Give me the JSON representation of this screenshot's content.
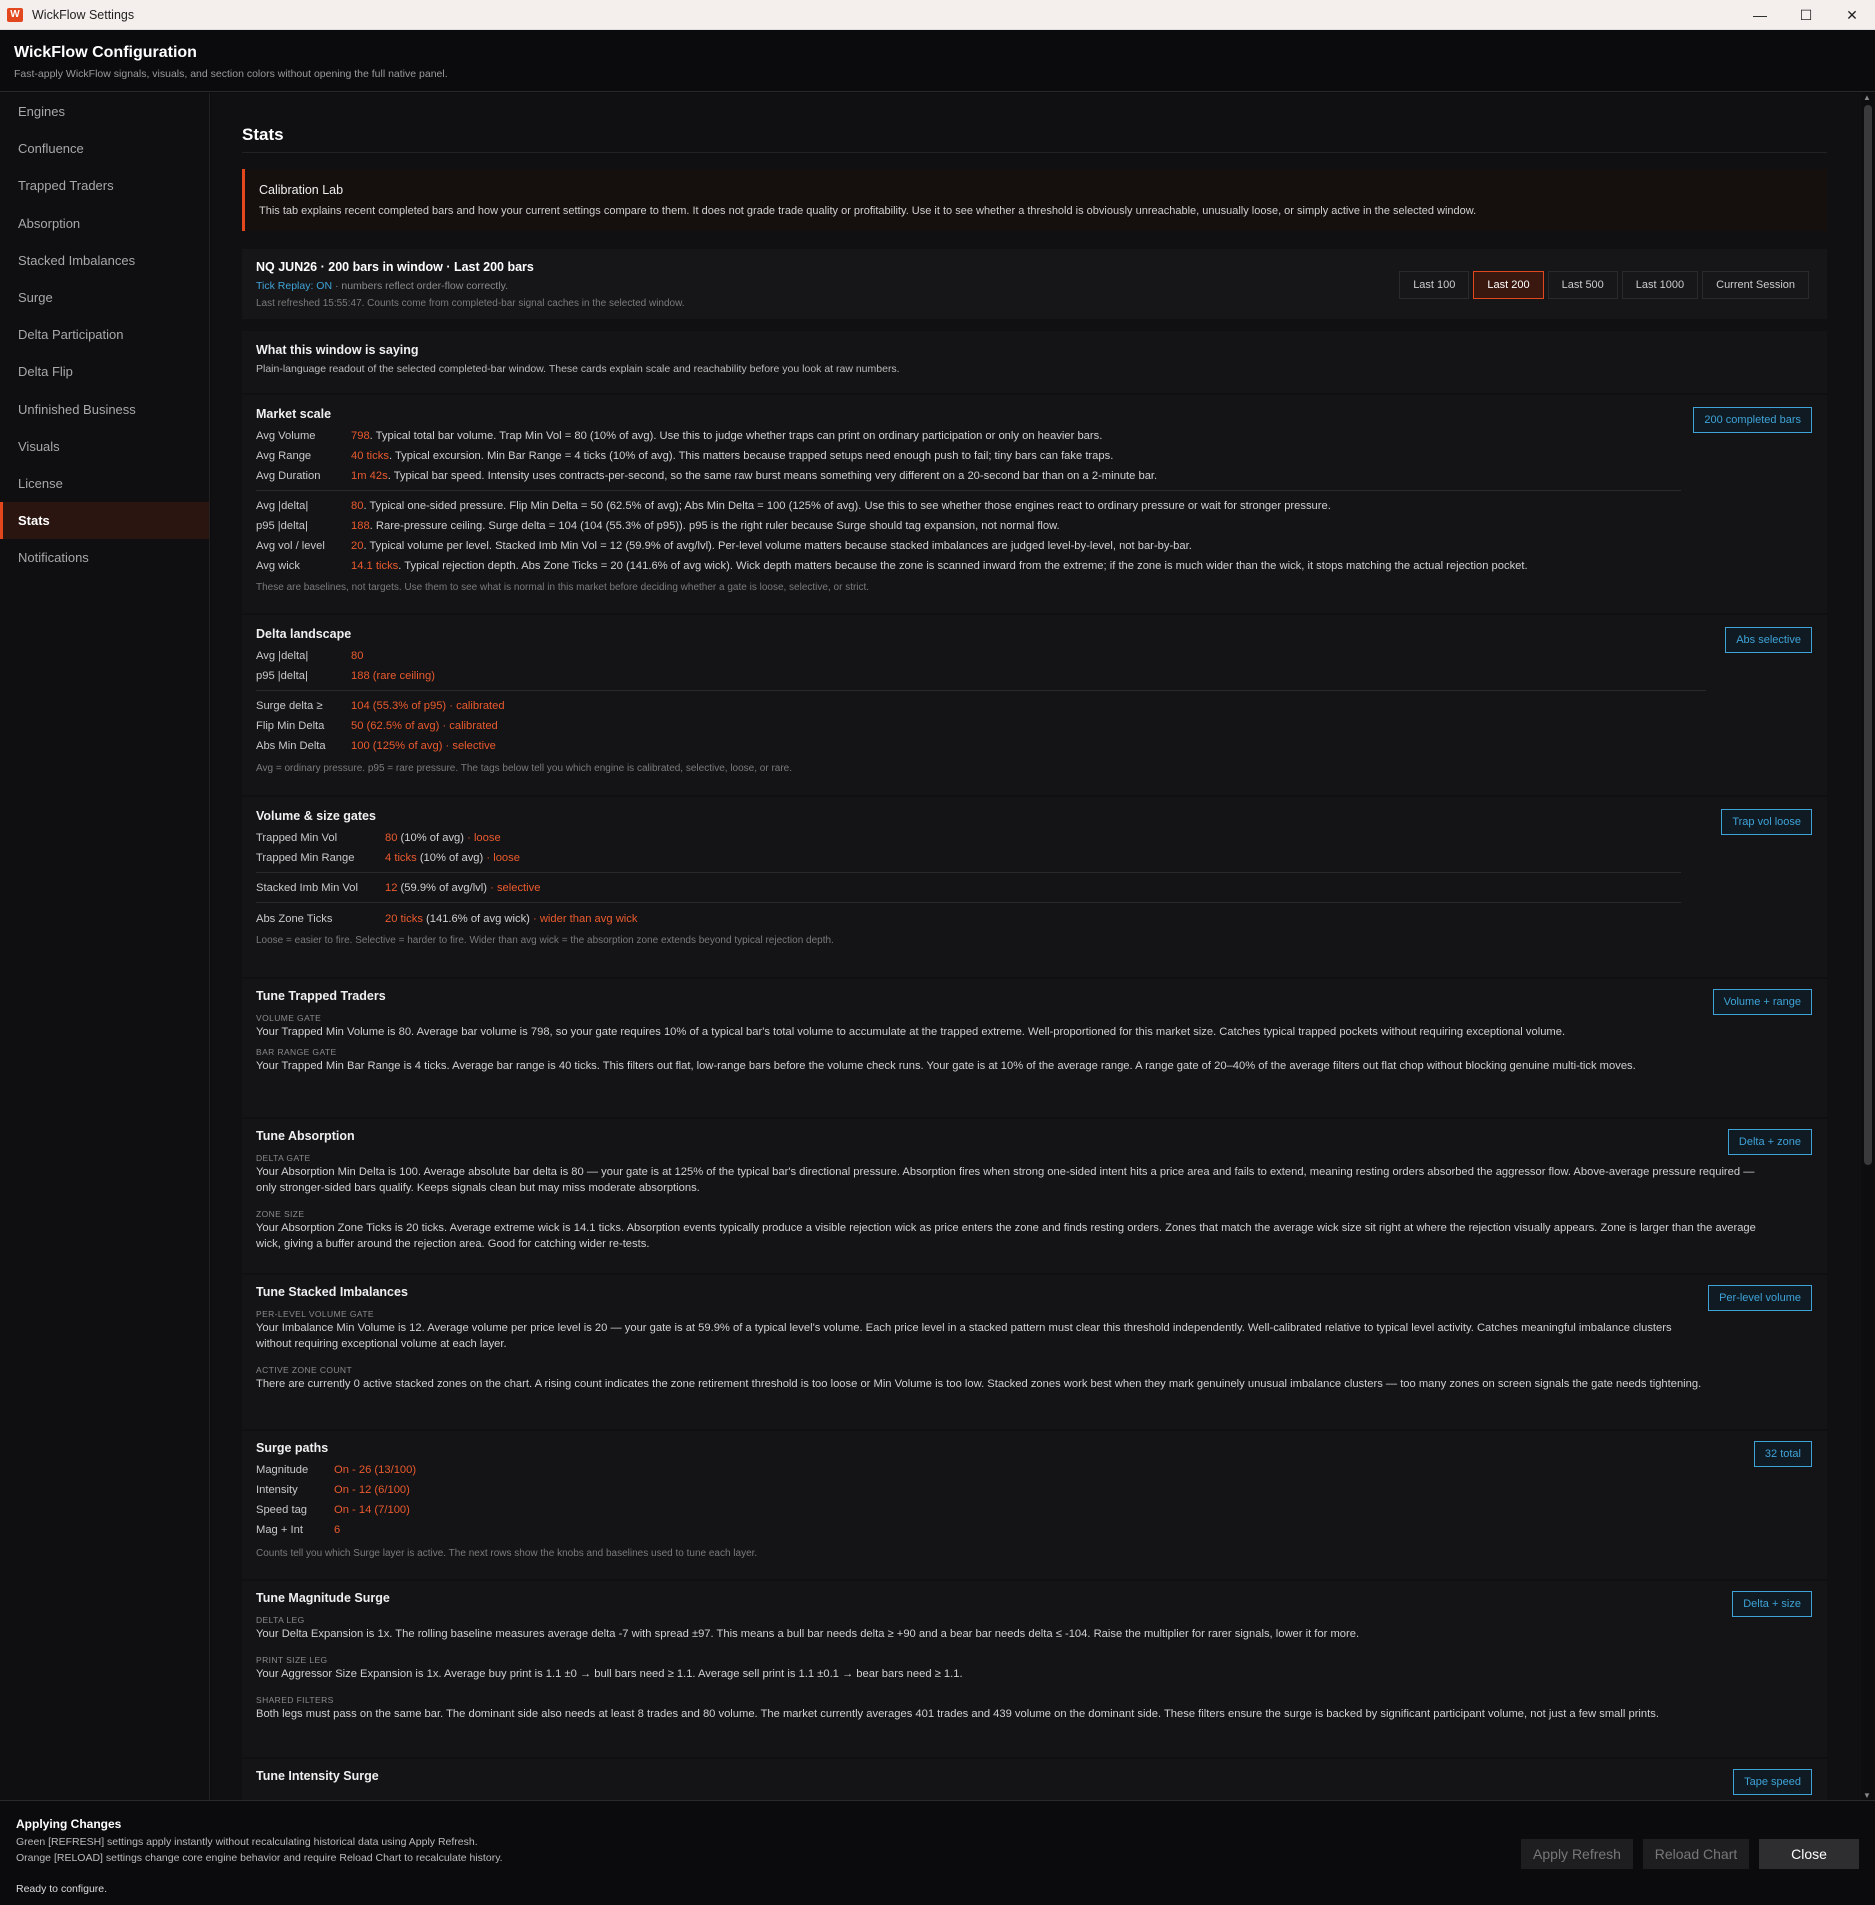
{
  "window": {
    "title": "WickFlow Settings"
  },
  "header": {
    "title": "WickFlow Configuration",
    "subtitle": "Fast-apply WickFlow signals, visuals, and section colors without opening the full native panel."
  },
  "sidebar": {
    "items": [
      {
        "label": "Engines"
      },
      {
        "label": "Confluence"
      },
      {
        "label": "Trapped Traders"
      },
      {
        "label": "Absorption"
      },
      {
        "label": "Stacked Imbalances"
      },
      {
        "label": "Surge"
      },
      {
        "label": "Delta Participation"
      },
      {
        "label": "Delta Flip"
      },
      {
        "label": "Unfinished Business"
      },
      {
        "label": "Visuals"
      },
      {
        "label": "License"
      },
      {
        "label": "Stats"
      },
      {
        "label": "Notifications"
      }
    ]
  },
  "page": {
    "title": "Stats"
  },
  "calib": {
    "title": "Calibration Lab",
    "body": "This tab explains recent completed bars and how your current settings compare to them. It does not grade trade quality or profitability. Use it to see whether a threshold is obviously unreachable, unusually loose, or simply active in the selected window."
  },
  "info": {
    "line1": "NQ JUN26  ·  200 bars in window  ·  Last 200 bars",
    "tick_replay": "Tick Replay: ON",
    "line2_rest": "  ·  numbers reflect order-flow correctly.",
    "line3": "Last refreshed 15:55:47. Counts come from completed-bar signal caches in the selected window.",
    "ranges": [
      "Last 100",
      "Last 200",
      "Last 500",
      "Last 1000",
      "Current Session"
    ],
    "selected_range": "Last 200"
  },
  "window_saying": {
    "title": "What this window is saying",
    "subtitle": "Plain-language readout of the selected completed-bar window. These cards explain scale and reachability before you look at raw numbers."
  },
  "market_scale": {
    "title": "Market scale",
    "badge": "200 completed bars",
    "rows": [
      {
        "k": "Avg Volume",
        "v": "798",
        "t": ". Typical total bar volume. Trap Min Vol = 80 (10% of avg). Use this to judge whether traps can print on ordinary participation or only on heavier bars."
      },
      {
        "k": "Avg Range",
        "v": "40 ticks",
        "t": ". Typical excursion. Min Bar Range = 4 ticks (10% of avg). This matters because trapped setups need enough push to fail; tiny bars can fake traps."
      },
      {
        "k": "Avg Duration",
        "v": "1m 42s",
        "t": ". Typical bar speed. Intensity uses contracts-per-second, so the same raw burst means something very different on a 20-second bar than on a 2-minute bar."
      },
      {
        "k": "Avg |delta|",
        "v": "80",
        "t": ". Typical one-sided pressure. Flip Min Delta = 50 (62.5% of avg); Abs Min Delta = 100 (125% of avg). Use this to see whether those engines react to ordinary pressure or wait for stronger pressure."
      },
      {
        "k": "p95 |delta|",
        "v": "188",
        "t": ". Rare-pressure ceiling. Surge delta = 104 (104  (55.3% of p95)). p95 is the right ruler because Surge should tag expansion, not normal flow."
      },
      {
        "k": "Avg vol / level",
        "v": "20",
        "t": ". Typical volume per level. Stacked Imb Min Vol = 12 (59.9% of avg/lvl). Per-level volume matters because stacked imbalances are judged level-by-level, not bar-by-bar."
      },
      {
        "k": "Avg wick",
        "v": "14.1 ticks",
        "t": ". Typical rejection depth. Abs Zone Ticks = 20 (141.6% of avg wick). Wick depth matters because the zone is scanned inward from the extreme; if the zone is much wider than the wick, it stops matching the actual rejection pocket."
      }
    ],
    "note": "These are baselines, not targets. Use them to see what is normal in this market before deciding whether a gate is loose, selective, or strict."
  },
  "delta_landscape": {
    "title": "Delta landscape",
    "badge": "Abs selective",
    "rows": [
      {
        "k": "Avg |delta|",
        "v": "80"
      },
      {
        "k": "p95 |delta|",
        "v": "188 (rare ceiling)"
      },
      {
        "k": "Surge delta ≥",
        "v": "104  (55.3% of p95)  · calibrated"
      },
      {
        "k": "Flip Min Delta",
        "v": "50  (62.5% of avg)  · calibrated"
      },
      {
        "k": "Abs Min Delta",
        "v": "100  (125% of avg)  · selective"
      }
    ],
    "note": "Avg = ordinary pressure. p95 = rare pressure. The tags below tell you which engine is calibrated, selective, loose, or rare."
  },
  "volume_gates": {
    "title": "Volume & size gates",
    "badge": "Trap vol loose",
    "rows": [
      {
        "k": "Trapped Min Vol",
        "v": "80",
        "m": "  (10% of avg)",
        "tag": "  · loose"
      },
      {
        "k": "Trapped Min Range",
        "v": "4 ticks",
        "m": "  (10% of avg)",
        "tag": "  · loose"
      },
      {
        "k": "Stacked Imb Min Vol",
        "v": "12",
        "m": "  (59.9% of avg/lvl)",
        "tag": "  · selective"
      },
      {
        "k": "Abs Zone Ticks",
        "v": "20 ticks",
        "m": "  (141.6% of avg wick)",
        "tag": "  · wider than avg wick"
      }
    ],
    "note": "Loose = easier to fire. Selective = harder to fire. Wider than avg wick = the absorption zone extends beyond typical rejection depth."
  },
  "tune_trapped": {
    "title": "Tune Trapped Traders",
    "badge": "Volume + range",
    "cap1": "VOLUME GATE",
    "p1": "Your Trapped Min Volume is 80. Average bar volume is 798, so your gate requires 10% of a typical bar's total volume to accumulate at the trapped extreme. Well-proportioned for this market size. Catches typical trapped pockets without requiring exceptional volume.",
    "cap2": "BAR RANGE GATE",
    "p2": "Your Trapped Min Bar Range is 4 ticks. Average bar range is 40 ticks. This filters out flat, low-range bars before the volume check runs. Your gate is at 10% of the average range. A range gate of 20–40% of the average filters out flat chop without blocking genuine multi-tick moves."
  },
  "tune_absorption": {
    "title": "Tune Absorption",
    "badge": "Delta + zone",
    "cap1": "DELTA GATE",
    "p1": "Your Absorption Min Delta is 100. Average absolute bar delta is 80 — your gate is at 125% of the typical bar's directional pressure. Absorption fires when strong one-sided intent hits a price area and fails to extend, meaning resting orders absorbed the aggressor flow. Above-average pressure required — only stronger-sided bars qualify. Keeps signals clean but may miss moderate absorptions.",
    "cap2": "ZONE SIZE",
    "p2": "Your Absorption Zone Ticks is 20 ticks. Average extreme wick is 14.1 ticks. Absorption events typically produce a visible rejection wick as price enters the zone and finds resting orders. Zones that match the average wick size sit right at where the rejection visually appears. Zone is larger than the average wick, giving a buffer around the rejection area. Good for catching wider re-tests."
  },
  "tune_stacked": {
    "title": "Tune Stacked Imbalances",
    "badge": "Per-level volume",
    "cap1": "PER-LEVEL VOLUME GATE",
    "p1": "Your Imbalance Min Volume is 12. Average volume per price level is 20 — your gate is at 59.9% of a typical level's volume. Each price level in a stacked pattern must clear this threshold independently. Well-calibrated relative to typical level activity. Catches meaningful imbalance clusters without requiring exceptional volume at each layer.",
    "cap2": "ACTIVE ZONE COUNT",
    "p2": "There are currently 0 active stacked zones on the chart. A rising count indicates the zone retirement threshold is too loose or Min Volume is too low. Stacked zones work best when they mark genuinely unusual imbalance clusters — too many zones on screen signals the gate needs tightening."
  },
  "surge_paths": {
    "title": "Surge paths",
    "badge": "32 total",
    "rows": [
      {
        "k": "Magnitude",
        "v": "On - 26 (13/100)"
      },
      {
        "k": "Intensity",
        "v": "On - 12 (6/100)"
      },
      {
        "k": "Speed tag",
        "v": "On - 14 (7/100)"
      },
      {
        "k": "Mag + Int",
        "v": "6"
      }
    ],
    "note": "Counts tell you which Surge layer is active. The next rows show the knobs and baselines used to tune each layer."
  },
  "tune_magnitude": {
    "title": "Tune Magnitude Surge",
    "badge": "Delta + size",
    "cap1": "DELTA LEG",
    "p1": "Your Delta Expansion is 1x. The rolling baseline measures average delta -7 with spread ±97. This means a bull bar needs delta ≥ +90 and a bear bar needs delta ≤ -104. Raise the multiplier for rarer signals, lower it for more.",
    "cap2": "PRINT SIZE LEG",
    "p2": "Your Aggressor Size Expansion is 1x. Average buy print is 1.1 ±0 → bull bars need ≥ 1.1. Average sell print is 1.1 ±0.1 → bear bars need ≥ 1.1.",
    "cap3": "SHARED FILTERS",
    "p3": "Both legs must pass on the same bar. The dominant side also needs at least 8 trades and 80 volume. The market currently averages 401 trades and 439 volume on the dominant side. These filters ensure the surge is backed by significant participant volume, not just a few small prints."
  },
  "tune_intensity": {
    "title": "Tune Intensity Surge",
    "badge": "Tape speed"
  },
  "footer": {
    "title": "Applying Changes",
    "line1": "Green [REFRESH] settings apply instantly without recalculating historical data using Apply Refresh.",
    "line2": "Orange [RELOAD] settings change core engine behavior and require Reload Chart to recalculate history.",
    "status": "Ready to configure.",
    "apply": "Apply Refresh",
    "reload": "Reload Chart",
    "close": "Close"
  },
  "colors": {
    "accent": "#e2471d",
    "value": "#ea5a2e",
    "badge": "#3fa3d8"
  }
}
